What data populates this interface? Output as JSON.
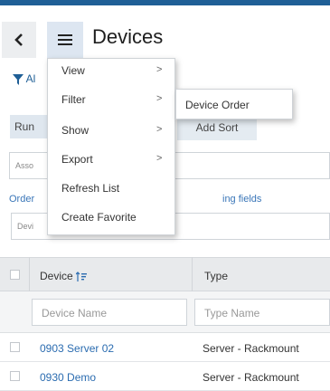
{
  "header": {
    "title": "Devices"
  },
  "background": {
    "filter_fragment": "Al",
    "run_fragment": "Run",
    "add_sort": "Add Sort",
    "assoc_fragment": "Asso",
    "order_fragment": "Order",
    "order_right_fragment": "ing fields",
    "device_field_fragment": "Devi"
  },
  "menu": {
    "items": [
      {
        "label": "View",
        "arrow": ">"
      },
      {
        "label": "Filter",
        "arrow": ">"
      },
      {
        "label": "Show",
        "arrow": ">"
      },
      {
        "label": "Export",
        "arrow": ">"
      },
      {
        "label": "Refresh List",
        "arrow": ""
      },
      {
        "label": "Create Favorite",
        "arrow": ""
      }
    ],
    "submenu": {
      "label": "Device Order"
    }
  },
  "table": {
    "columns": [
      {
        "label": "Device",
        "placeholder": "Device Name"
      },
      {
        "label": "Type",
        "placeholder": "Type Name"
      }
    ],
    "rows": [
      {
        "device": "0903 Server 02",
        "type": "Server - Rackmount"
      },
      {
        "device": "0930 Demo",
        "type": "Server - Rackmount"
      }
    ]
  },
  "colors": {
    "accent": "#1f5f96",
    "link": "#2b6cb0"
  },
  "icons": [
    "back-arrow-icon",
    "hamburger-menu-icon",
    "filter-funnel-icon",
    "sort-icon"
  ]
}
